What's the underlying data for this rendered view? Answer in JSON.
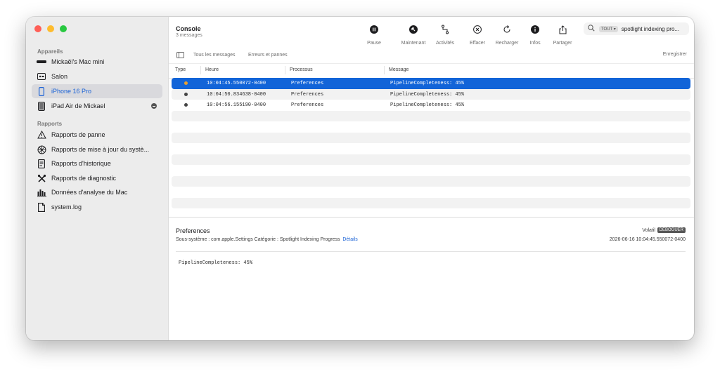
{
  "sidebar": {
    "devices_header": "Appareils",
    "devices": [
      {
        "label": "Mickaël's Mac mini",
        "icon": "mac-mini-icon",
        "selected": false
      },
      {
        "label": "Salon",
        "icon": "apple-tv-icon",
        "selected": false
      },
      {
        "label": "iPhone 16 Pro",
        "icon": "iphone-icon",
        "selected": true
      },
      {
        "label": "iPad Air de Mickael",
        "icon": "ipad-icon",
        "selected": false
      }
    ],
    "reports_header": "Rapports",
    "reports": [
      {
        "label": "Rapports de panne",
        "icon": "warning-icon"
      },
      {
        "label": "Rapports de mise à jour du systè...",
        "icon": "spinner-icon"
      },
      {
        "label": "Rapports d'historique",
        "icon": "document-icon"
      },
      {
        "label": "Rapports de diagnostic",
        "icon": "tools-icon"
      },
      {
        "label": "Données d'analyse du Mac",
        "icon": "bar-chart-icon"
      },
      {
        "label": "system.log",
        "icon": "file-icon"
      }
    ]
  },
  "header": {
    "title": "Console",
    "subtitle": "3 messages"
  },
  "toolbar": {
    "pause": "Pause",
    "now": "Maintenant",
    "activities": "Activités",
    "clear": "Effacer",
    "reload": "Recharger",
    "info": "Infos",
    "share": "Partager"
  },
  "search": {
    "scope": "TOUT ▾",
    "query": "spotlight indexing pro..."
  },
  "filters": {
    "all": "Tous les messages",
    "errors": "Erreurs et pannes",
    "save": "Enregistrer"
  },
  "table": {
    "columns": {
      "type": "Type",
      "time": "Heure",
      "process": "Processus",
      "message": "Message"
    },
    "rows": [
      {
        "time": "10:04:45.550072-0400",
        "process": "Preferences",
        "message": "PipelineCompleteness: 45%"
      },
      {
        "time": "10:04:50.834638-0400",
        "process": "Preferences",
        "message": "PipelineCompleteness: 45%"
      },
      {
        "time": "10:04:56.155190-0400",
        "process": "Preferences",
        "message": "PipelineCompleteness: 45%"
      }
    ]
  },
  "detail": {
    "title": "Preferences",
    "subsystem": "Sous-système : com.apple.Settings  Catégorie : Spotlight Indexing Progress",
    "link": "Détails",
    "volatile": "Volatil",
    "level": "DÉBOGUER",
    "timestamp": "2026-06-16 10:04:45.550072-0400",
    "body": "PipelineCompleteness: 45%"
  },
  "colors": {
    "accent": "#1264d8",
    "selected_sidebar_text": "#1a62d6"
  }
}
